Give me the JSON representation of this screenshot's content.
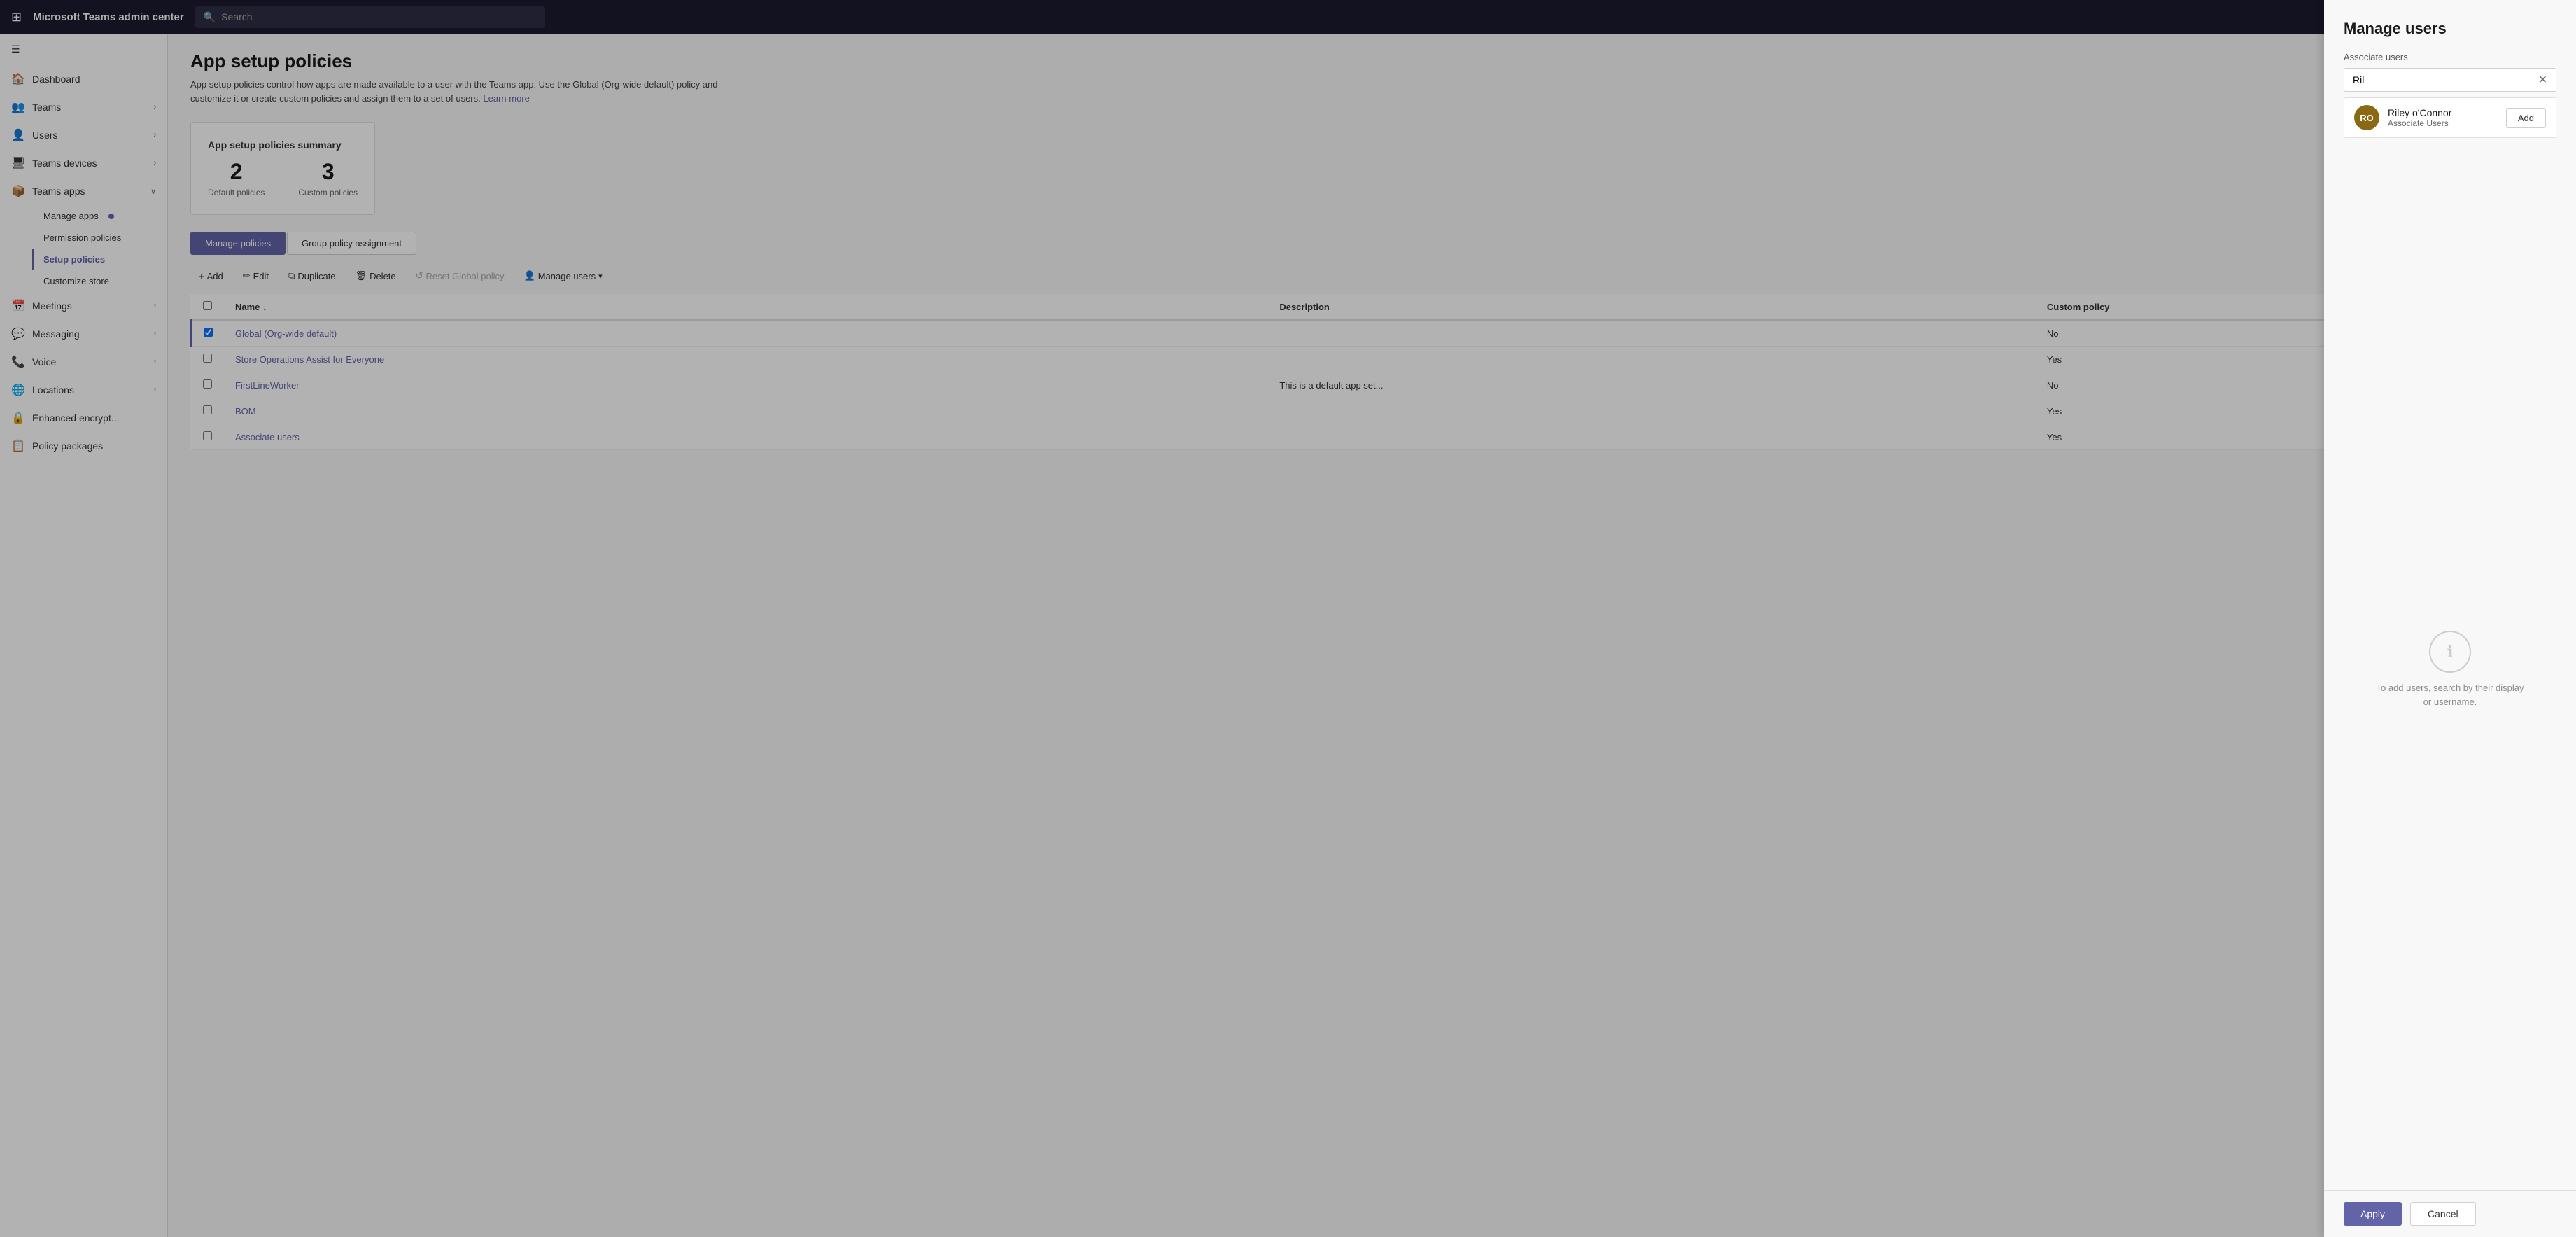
{
  "app": {
    "title": "Microsoft Teams admin center"
  },
  "topbar": {
    "search_placeholder": "Search"
  },
  "sidebar": {
    "hamburger_label": "Menu",
    "items": [
      {
        "id": "dashboard",
        "label": "Dashboard",
        "icon": "🏠",
        "expandable": false
      },
      {
        "id": "teams",
        "label": "Teams",
        "icon": "👥",
        "expandable": true
      },
      {
        "id": "users",
        "label": "Users",
        "icon": "👤",
        "expandable": true
      },
      {
        "id": "teams-devices",
        "label": "Teams devices",
        "icon": "🖥",
        "expandable": true
      },
      {
        "id": "teams-apps",
        "label": "Teams apps",
        "icon": "📦",
        "expandable": true
      },
      {
        "id": "meetings",
        "label": "Meetings",
        "icon": "📅",
        "expandable": true
      },
      {
        "id": "messaging",
        "label": "Messaging",
        "icon": "💬",
        "expandable": true
      },
      {
        "id": "voice",
        "label": "Voice",
        "icon": "📞",
        "expandable": true
      },
      {
        "id": "locations",
        "label": "Locations",
        "icon": "🌐",
        "expandable": true
      },
      {
        "id": "enhanced-encrypt",
        "label": "Enhanced encrypt...",
        "icon": "🔒",
        "expandable": false
      },
      {
        "id": "policy-packages",
        "label": "Policy packages",
        "icon": "📋",
        "expandable": false
      }
    ],
    "subitems": {
      "teams-apps": [
        {
          "id": "manage-apps",
          "label": "Manage apps",
          "has_dot": true
        },
        {
          "id": "permission-policies",
          "label": "Permission policies"
        },
        {
          "id": "setup-policies",
          "label": "Setup policies",
          "active": true
        },
        {
          "id": "customize-store",
          "label": "Customize store"
        }
      ]
    }
  },
  "page": {
    "title": "App setup policies",
    "description": "App setup policies control how apps are made available to a user with the Teams app. Use the Global (Org-wide default) policy and customize it or create custom policies and assign them to a set of users.",
    "learn_more": "Learn more"
  },
  "summary": {
    "title": "App setup policies summary",
    "default_policies_count": "2",
    "default_policies_label": "Default policies",
    "custom_policies_count": "3",
    "custom_policies_label": "Custom policies"
  },
  "tabs": [
    {
      "id": "manage-policies",
      "label": "Manage policies",
      "active": true
    },
    {
      "id": "group-policy-assignment",
      "label": "Group policy assignment",
      "active": false
    }
  ],
  "toolbar": {
    "add_label": "Add",
    "edit_label": "Edit",
    "duplicate_label": "Duplicate",
    "delete_label": "Delete",
    "reset_label": "Reset Global policy",
    "manage_users_label": "Manage users",
    "manage_users_chevron": "▾"
  },
  "table": {
    "columns": [
      {
        "id": "name",
        "label": "Name",
        "sort": "↓"
      },
      {
        "id": "description",
        "label": "Description"
      },
      {
        "id": "custom_policy",
        "label": "Custom policy"
      }
    ],
    "rows": [
      {
        "id": 1,
        "name": "Global (Org-wide default)",
        "description": "",
        "custom_policy": "No",
        "selected": true
      },
      {
        "id": 2,
        "name": "Store Operations Assist for Everyone",
        "description": "",
        "custom_policy": "Yes"
      },
      {
        "id": 3,
        "name": "FirstLineWorker",
        "description": "This is a default app set...",
        "custom_policy": "No"
      },
      {
        "id": 4,
        "name": "BOM",
        "description": "",
        "custom_policy": "Yes"
      },
      {
        "id": 5,
        "name": "Associate users",
        "description": "",
        "custom_policy": "Yes"
      }
    ]
  },
  "panel": {
    "title": "Manage users",
    "subtitle": "Associate users",
    "search_value": "Ril",
    "search_placeholder": "",
    "user_result": {
      "initials": "RO",
      "name": "Riley o'Connor",
      "role": "Associate Users",
      "add_label": "Add"
    },
    "empty_state_text": "To add users, search by their display or username.",
    "apply_label": "Apply",
    "cancel_label": "Cancel"
  }
}
